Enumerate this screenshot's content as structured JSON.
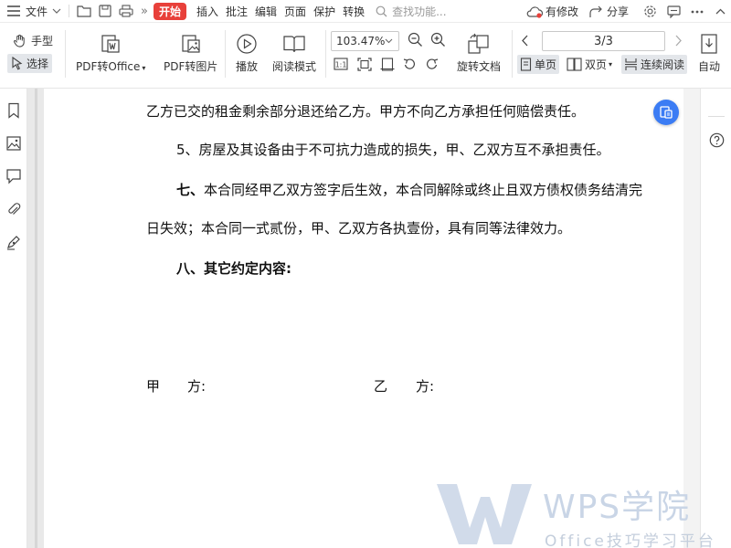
{
  "menubar": {
    "file": "文件",
    "tabs": [
      "开始",
      "插入",
      "批注",
      "编辑",
      "页面",
      "保护",
      "转换"
    ],
    "search_placeholder": "查找功能...",
    "has_changes": "有修改",
    "share": "分享"
  },
  "ribbon": {
    "hand_tool": "手型",
    "select_tool": "选择",
    "pdf_to_office": "PDF转Office",
    "pdf_to_image": "PDF转图片",
    "play": "播放",
    "reading_mode": "阅读模式",
    "zoom": "103.47%",
    "rotate_doc": "旋转文档",
    "page_indicator": "3/3",
    "single_page": "单页",
    "double_page": "双页",
    "continuous": "连续阅读",
    "auto": "自动"
  },
  "document": {
    "lines": [
      "乙方已交的租金剩余部分退还给乙方。甲方不向乙方承担任何赔偿责任。",
      "5、房屋及其设备由于不可抗力造成的损失，甲、乙双方互不承担责任。",
      "七、",
      "本合同经甲乙双方签字后生效，本合同解除或终止且双方债权债务结清完",
      "日失效；本合同一式贰份，甲、乙双方各执壹份，具有同等法律效力。",
      "八、其它约定内容:"
    ],
    "party_a": "甲",
    "party_a_colon": "方:",
    "party_b": "乙",
    "party_b_colon": "方:"
  },
  "watermark": {
    "brand": "WPS学院",
    "tagline": "Office技巧学习平台"
  },
  "colors": {
    "accent_red": "#e8403a",
    "accent_blue": "#3b7cf4",
    "watermark": "#c9d5e6"
  }
}
